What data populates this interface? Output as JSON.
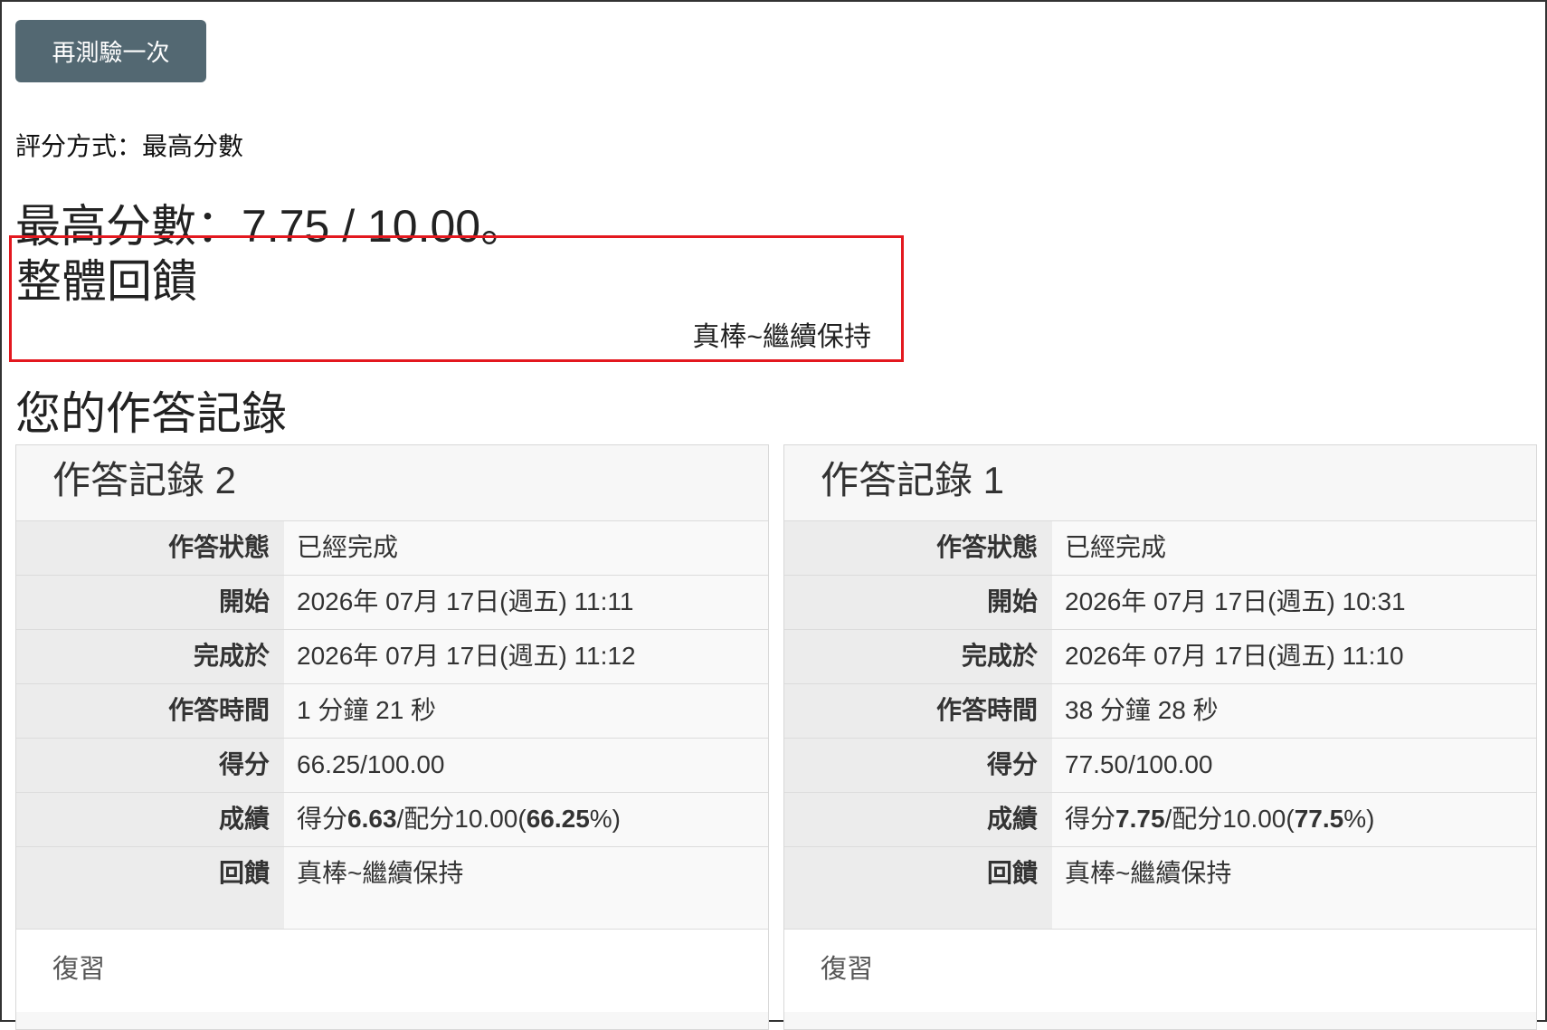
{
  "retry_button": "再測驗一次",
  "grading_method": "評分方式：最高分數",
  "highest_score": "最高分數：7.75 / 10.00。",
  "overall_feedback": {
    "title": "整體回饋",
    "text": "真棒~繼續保持"
  },
  "records_title": "您的作答記錄",
  "labels": {
    "status": "作答狀態",
    "start": "開始",
    "completed": "完成於",
    "duration": "作答時間",
    "score": "得分",
    "grade": "成績",
    "feedback": "回饋"
  },
  "attempts": [
    {
      "title": "作答記錄 2",
      "status": "已經完成",
      "start": "2026年 07月 17日(週五) 11:11",
      "completed": "2026年 07月 17日(週五) 11:12",
      "duration": "1 分鐘 21 秒",
      "score": "66.25/100.00",
      "grade_prefix": "得分",
      "grade_points": "6.63",
      "grade_mid": "/配分10.00(",
      "grade_percent": "66.25",
      "grade_suffix": "%)",
      "feedback": "真棒~繼續保持",
      "review": "復習"
    },
    {
      "title": "作答記錄 1",
      "status": "已經完成",
      "start": "2026年 07月 17日(週五) 10:31",
      "completed": "2026年 07月 17日(週五) 11:10",
      "duration": "38 分鐘 28 秒",
      "score": "77.50/100.00",
      "grade_prefix": "得分",
      "grade_points": "7.75",
      "grade_mid": "/配分10.00(",
      "grade_percent": "77.5",
      "grade_suffix": "%)",
      "feedback": "真棒~繼續保持",
      "review": "復習"
    }
  ]
}
